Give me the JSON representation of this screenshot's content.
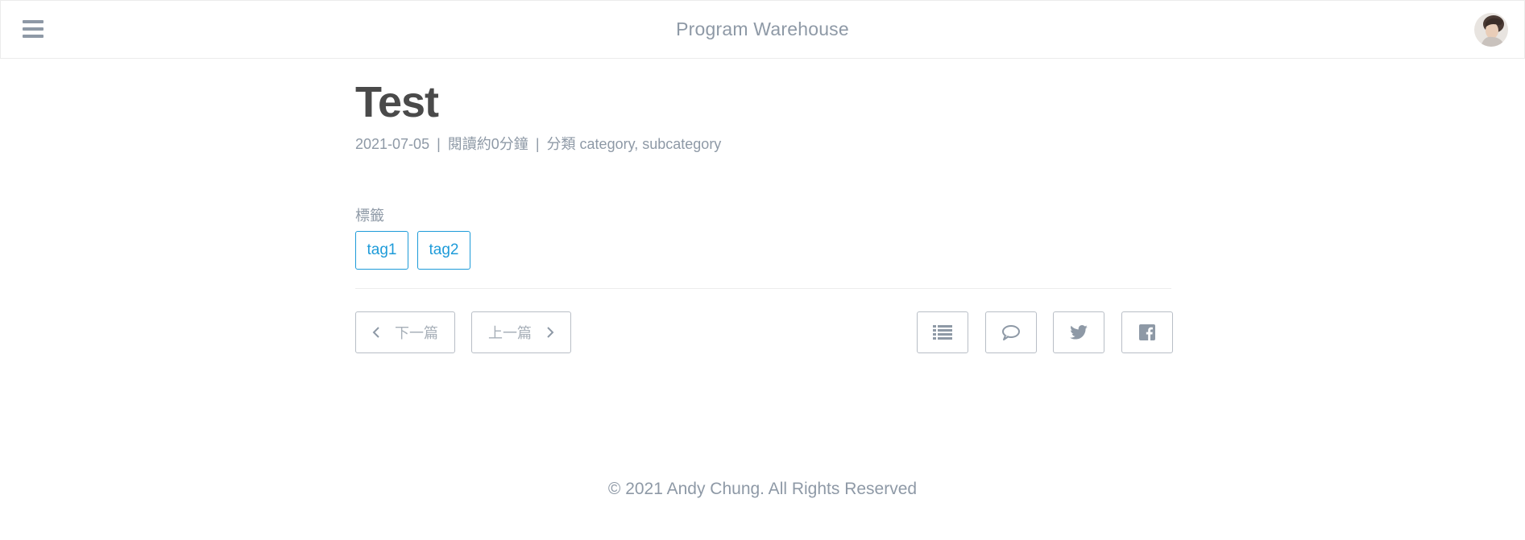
{
  "header": {
    "menu_icon": "hamburger-menu-icon",
    "title": "Program Warehouse",
    "avatar_icon": "user-avatar"
  },
  "post": {
    "title": "Test",
    "date": "2021-07-05",
    "separator": "|",
    "read_time": "閱讀約0分鐘",
    "category_label": "分類",
    "categories": "category, subcategory"
  },
  "tags": {
    "label": "標籤",
    "items": [
      "tag1",
      "tag2"
    ],
    "color": "#1d9bd9"
  },
  "post_nav": {
    "next_label": "下一篇",
    "prev_label": "上一篇"
  },
  "actions": {
    "icons": [
      "list-icon",
      "comment-icon",
      "twitter-icon",
      "facebook-icon"
    ]
  },
  "footer": {
    "copyright": "© 2021 Andy Chung. All Rights Reserved"
  }
}
